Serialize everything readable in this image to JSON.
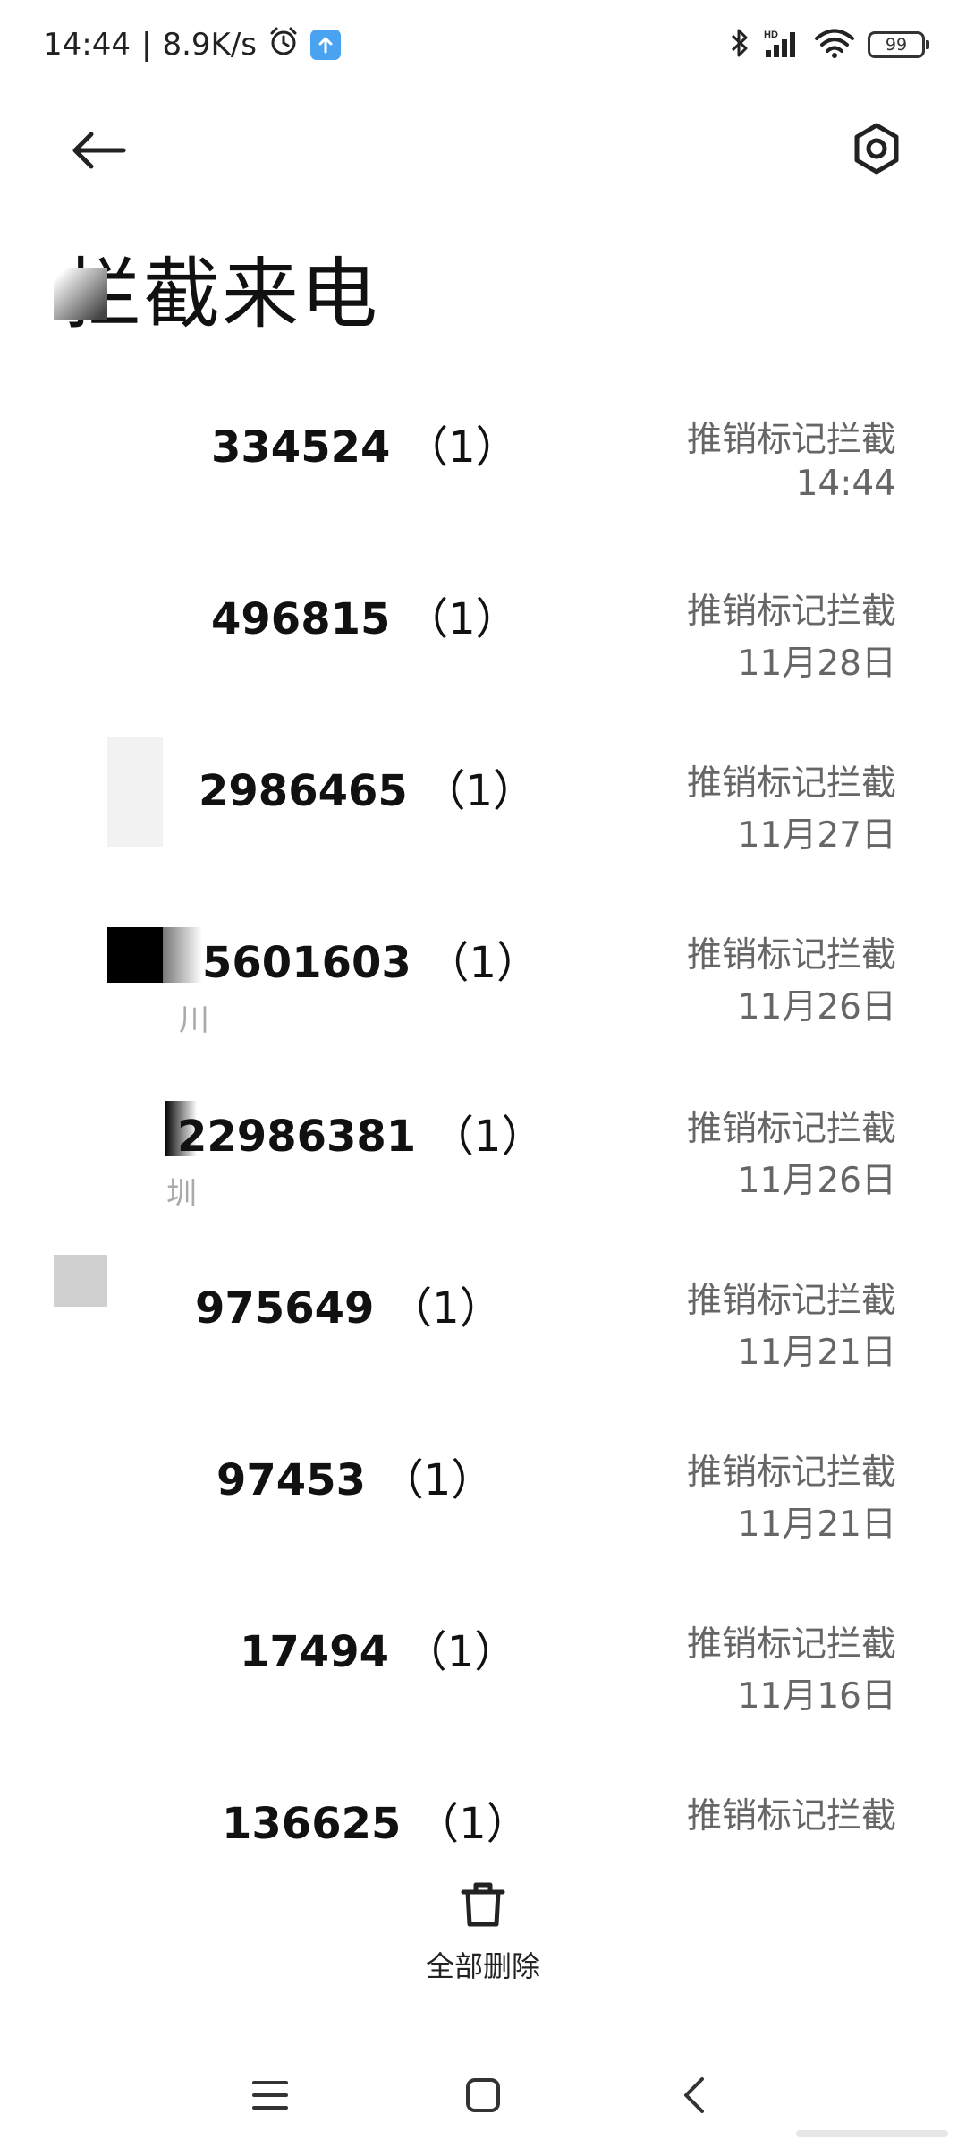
{
  "status_bar": {
    "time": "14:44",
    "separator": "|",
    "net_speed": "8.9K/s",
    "battery": "99"
  },
  "header": {
    "title": "拦截来电",
    "back_icon": "back-arrow-icon",
    "settings_icon": "settings-icon"
  },
  "calls": [
    {
      "number": "334524",
      "count": "（1）",
      "tag": "推销标记拦截",
      "time": "14:44"
    },
    {
      "number": "496815",
      "count": "（1）",
      "tag": "推销标记拦截",
      "time": "11月28日"
    },
    {
      "number": "2986465",
      "count": "（1）",
      "tag": "推销标记拦截",
      "time": "11月27日"
    },
    {
      "number": "5601603",
      "count": "（1）",
      "tag": "推销标记拦截",
      "time": "11月26日",
      "sub": "川"
    },
    {
      "number": "22986381",
      "count": "（1）",
      "tag": "推销标记拦截",
      "time": "11月26日",
      "sub": "圳"
    },
    {
      "number": "975649",
      "count": "（1）",
      "tag": "推销标记拦截",
      "time": "11月21日"
    },
    {
      "number": "97453",
      "count": "（1）",
      "tag": "推销标记拦截",
      "time": "11月21日"
    },
    {
      "number": "17494",
      "count": "（1）",
      "tag": "推销标记拦截",
      "time": "11月16日"
    },
    {
      "number": "136625",
      "count": "（1）",
      "tag": "推销标记拦截",
      "time": ""
    }
  ],
  "actions": {
    "delete_all": "全部删除"
  },
  "nav": {
    "menu_icon": "menu-icon",
    "home_icon": "home-icon",
    "back_icon": "nav-back-icon"
  },
  "colors": {
    "text_primary": "#111111",
    "text_secondary": "#666666",
    "upload_badge": "#4aa3f0"
  }
}
